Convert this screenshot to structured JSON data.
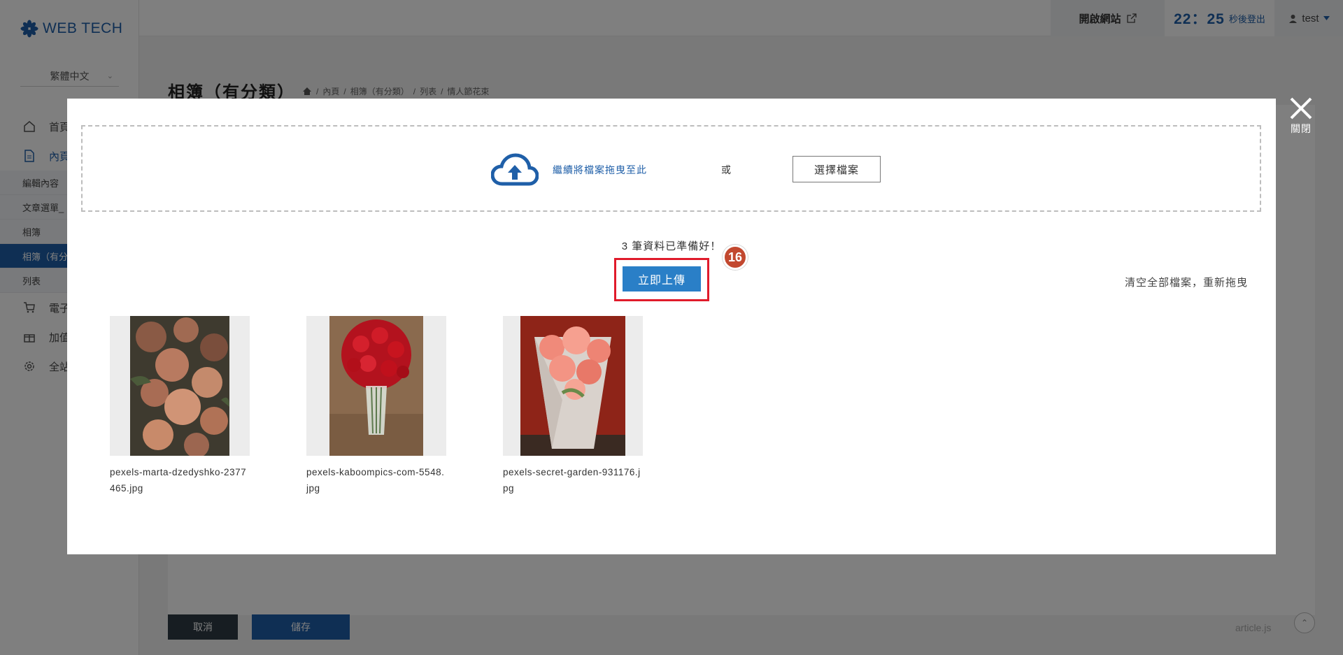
{
  "app": {
    "logo_text": "WEB TECH",
    "language": "繁體中文"
  },
  "sidebar": {
    "items": [
      {
        "label": "首頁",
        "icon": "home-icon"
      },
      {
        "label": "內頁",
        "icon": "document-icon"
      }
    ],
    "sub_items": [
      "編輯內容",
      "文章選單_",
      "相簿",
      "相簿（有分",
      "列表"
    ],
    "items_after": [
      {
        "label": "電子",
        "icon": "cart-icon"
      },
      {
        "label": "加值",
        "icon": "gift-icon"
      },
      {
        "label": "全站",
        "icon": "gear-icon"
      }
    ]
  },
  "topbar": {
    "open_site_label": "開啟網站",
    "timer_value": "22：25",
    "timer_label": "秒後登出",
    "user_name": "test"
  },
  "page": {
    "title": "相簿（有分類）",
    "breadcrumb": [
      "內頁",
      "相簿（有分類）",
      "列表",
      "情人節花束"
    ],
    "cancel_label": "取消",
    "save_label": "儲存",
    "footer_file": "article.js"
  },
  "modal": {
    "close_label": "關閉",
    "drop_text": "繼續將檔案拖曳至此",
    "or_text": "或",
    "choose_label": "選擇檔案",
    "ready_text": "3 筆資料已準備好！",
    "upload_label": "立即上傳",
    "step_number": "16",
    "clear_label": "清空全部檔案，重新拖曳",
    "files": [
      {
        "name": "pexels-marta-dzedyshko-2377465.jpg"
      },
      {
        "name": "pexels-kaboompics-com-5548.jpg"
      },
      {
        "name": "pexels-secret-garden-931176.jpg"
      }
    ]
  },
  "colors": {
    "accent": "#1f5fa8",
    "upload_button": "#2a7fc7",
    "highlight": "#e01b2b",
    "badge": "#c2482f"
  }
}
